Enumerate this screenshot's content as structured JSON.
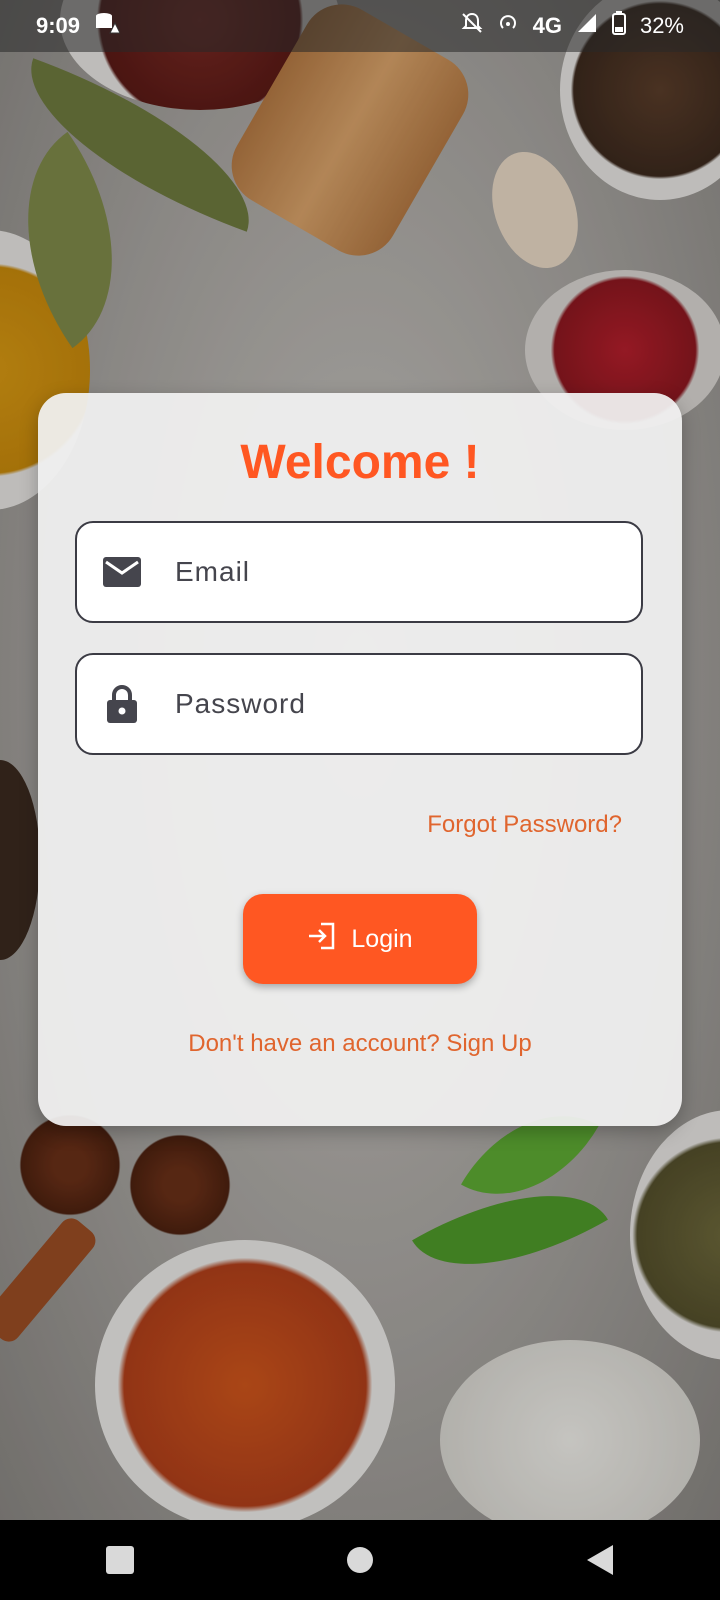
{
  "status_bar": {
    "time": "9:09",
    "network": "4G",
    "battery": "32%",
    "icons": [
      "data-saver-alert-icon",
      "notifications-off-icon",
      "hotspot-icon",
      "signal-icon",
      "battery-icon"
    ]
  },
  "login_card": {
    "title": "Welcome !",
    "email_placeholder": "Email",
    "password_placeholder": "Password",
    "forgot_password": "Forgot Password?",
    "login_button": "Login",
    "signup_prompt": "Don't have an account? Sign Up"
  },
  "colors": {
    "accent": "#ff5722",
    "link": "#e0652e",
    "field_text": "#45454d"
  },
  "nav_bar": {
    "icons": [
      "recent-apps-icon",
      "home-icon",
      "back-icon"
    ]
  }
}
